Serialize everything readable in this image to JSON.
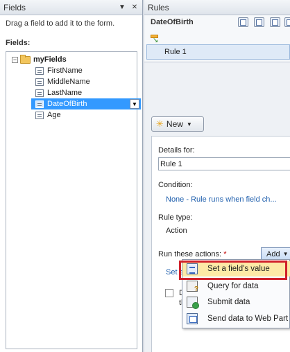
{
  "fields_pane": {
    "title": "Fields",
    "hint": "Drag a field to add it to the form.",
    "fields_label": "Fields:",
    "tree": {
      "expander": "−",
      "root": "myFields",
      "items": [
        "FirstName",
        "MiddleName",
        "LastName",
        "DateOfBirth",
        "Age"
      ],
      "selected_index": 3
    },
    "header_buttons": {
      "menu": "▼",
      "close": "✕"
    }
  },
  "rules_pane": {
    "title": "Rules",
    "target_field": "DateOfBirth",
    "rules": [
      "Rule 1"
    ],
    "new_button_label": "New",
    "details_for_label": "Details for:",
    "rule_name_value": "Rule 1",
    "condition_label": "Condition:",
    "condition_value": "None - Rule runs when field ch...",
    "rule_type_label": "Rule type:",
    "rule_type_value": "Action",
    "run_actions_label": "Run these actions:",
    "required_marker": "*",
    "add_button_label": "Add",
    "partial_link": "Set a",
    "checkbox_fragment_1": "D",
    "checkbox_fragment_2": "th"
  },
  "add_menu": {
    "items": [
      "Set a field's value",
      "Query for data",
      "Submit data",
      "Send data to Web Part"
    ],
    "highlighted_index": 0
  },
  "colors": {
    "selection": "#3399ff",
    "menu_highlight": "#fde9a6",
    "callout_border": "#d0202a",
    "link": "#1f5fad"
  }
}
